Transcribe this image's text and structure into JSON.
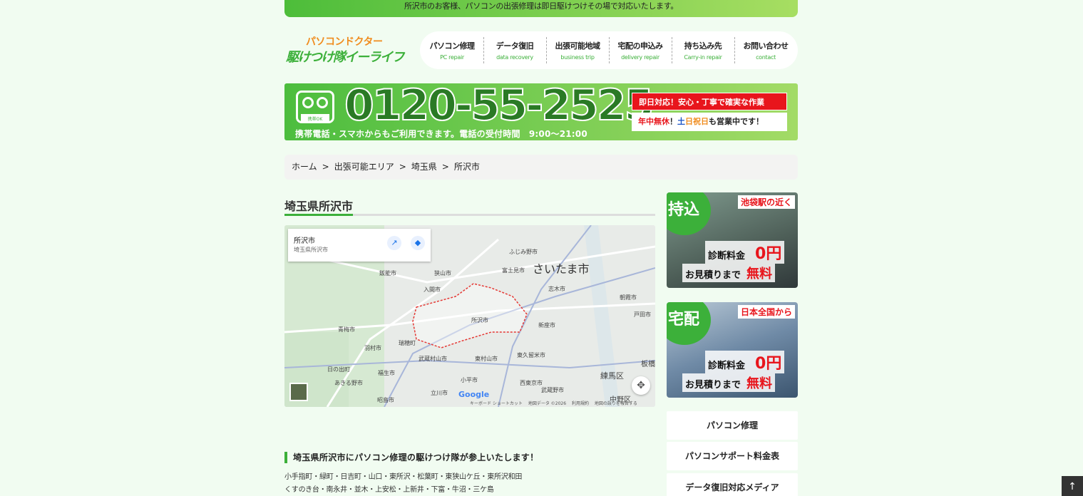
{
  "topbar": {
    "text": "所沢市のお客様、パソコンの出張修理は即日駆けつけその場で対応いたします。"
  },
  "logo": {
    "line1": "パソコンドクター",
    "line2": "駆けつけ隊イーライフ"
  },
  "nav": [
    {
      "ja": "パソコン修理",
      "en": "PC repair"
    },
    {
      "ja": "データ復旧",
      "en": "data recovery"
    },
    {
      "ja": "出張可能地域",
      "en": "business trip"
    },
    {
      "ja": "宅配の申込み",
      "en": "delivery repair"
    },
    {
      "ja": "持ち込み先",
      "en": "Carry-in repair"
    },
    {
      "ja": "お問い合わせ",
      "en": "contact"
    }
  ],
  "phone": {
    "freedial_label": "携帯OK",
    "number": "0120-55-2525",
    "sub": "携帯電話・スマホからもご利用できます。電話の受付時間　9:00～21:00",
    "red_box": "即日対応！安心・丁寧で確実な作業",
    "white_box": {
      "p1": "年中無休",
      "p2": "！",
      "p3": "土",
      "p4": "日祝日",
      "p5": "も営業中です！"
    }
  },
  "breadcrumb": {
    "items": [
      "ホーム",
      "出張可能エリア",
      "埼玉県",
      "所沢市"
    ],
    "sep": ">"
  },
  "page_title": "埼玉県所沢市",
  "map": {
    "card_title": "所沢市",
    "card_sub": "埼玉県所沢市",
    "labels": [
      "ふじみ野市",
      "富士見市",
      "飯能市",
      "狭山市",
      "志木市",
      "入間市",
      "朝霞市",
      "所沢市",
      "新座市",
      "青梅市",
      "羽村市",
      "瑞穂町",
      "武蔵村山市",
      "東村山市",
      "東久留米市",
      "練馬区",
      "日の出町",
      "福生市",
      "小平市",
      "西東京市",
      "武蔵野市",
      "あきる野市",
      "昭島市",
      "立川市",
      "中野区",
      "板橋",
      "戸田市"
    ],
    "city_big": "さいたま市",
    "footer": [
      "キーボード ショートカット",
      "地図データ ©2026",
      "利用規約",
      "地図の誤りを報告する"
    ],
    "google": "Google"
  },
  "section_heading": "埼玉県所沢市にパソコン修理の駆けつけ隊が参上いたします！",
  "areas": [
    "小手指町・緑町・日吉町・山口・東所沢・松葉町・東狭山ケ丘・東所沢和田",
    "くすのき台・南永井・並木・上安松・上新井・下富・牛沼・三ケ島"
  ],
  "banner1": {
    "badge": "持込",
    "tag": "池袋駅の近く",
    "line1": "診断料金",
    "zero": "0円",
    "line2": "お見積りまで",
    "free": "無料"
  },
  "banner2": {
    "badge": "宅配",
    "tag": "日本全国から",
    "line1": "診断料金",
    "zero": "0円",
    "line2": "お見積りまで",
    "free": "無料"
  },
  "side_links": [
    "パソコン修理",
    "パソコンサポート料金表",
    "データ復旧対応メディア"
  ],
  "totop": "↑"
}
